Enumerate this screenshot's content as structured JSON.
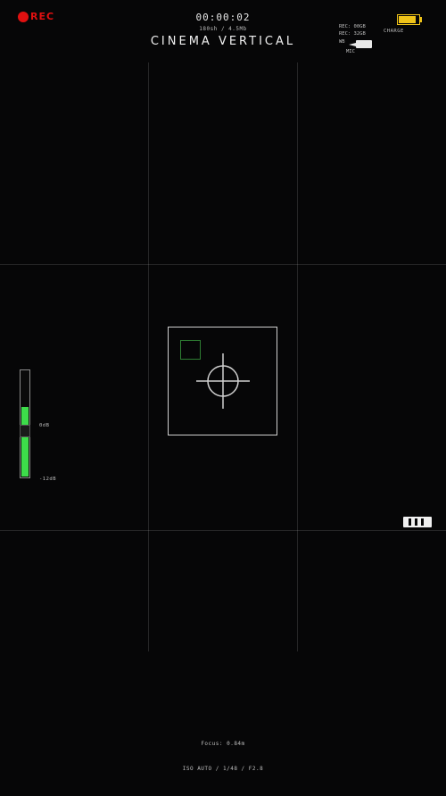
{
  "recording": {
    "label": "REC",
    "color": "#e01010"
  },
  "header": {
    "timecode": "00:00:02",
    "shutter_fps": "180sh / 4.5Mb",
    "mode_title": "CINEMA VERTICAL"
  },
  "status": {
    "storage_line_1": "REC: 00GB",
    "storage_line_2": "REC: 32GB",
    "wb_label": "WB",
    "mic_label": "MIC",
    "battery_label": "CHARGE",
    "battery_level": 0.85,
    "battery_color": "#f0c419"
  },
  "viewfinder": {
    "af_indicator_color": "#2e7d32",
    "crosshair_icon": "crosshair-icon"
  },
  "audio_meter": {
    "level": 0.65,
    "top_label": "0dB",
    "bottom_label": "-12dB",
    "fill_color": "#3ddc4a"
  },
  "footer": {
    "focus_readout": "Focus: 0.84m",
    "exposure_readout": "ISO AUTO / 1/48 / F2.8"
  }
}
